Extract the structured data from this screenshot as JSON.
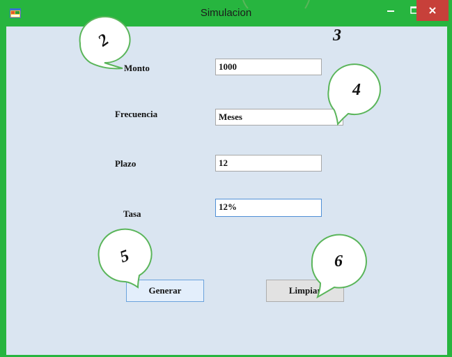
{
  "window": {
    "title": "Simulacion",
    "icon": "app-window-icon",
    "controls": {
      "minimize": "–",
      "maximize": "□",
      "close": "✕"
    },
    "colors": {
      "frame": "#27b53f",
      "client": "#dae5f1",
      "close": "#c7403a"
    }
  },
  "form": {
    "monto": {
      "label": "Monto",
      "value": "1000"
    },
    "frecuencia": {
      "label": "Frecuencia",
      "value": "Meses"
    },
    "plazo": {
      "label": "Plazo",
      "value": "12"
    },
    "tasa": {
      "label": "Tasa",
      "value": "12%"
    }
  },
  "buttons": {
    "generar": "Generar",
    "limpiar": "Limpiar"
  },
  "annotations": {
    "n2": "2",
    "n3": "3",
    "n4": "4",
    "n5": "5",
    "n6": "6"
  }
}
